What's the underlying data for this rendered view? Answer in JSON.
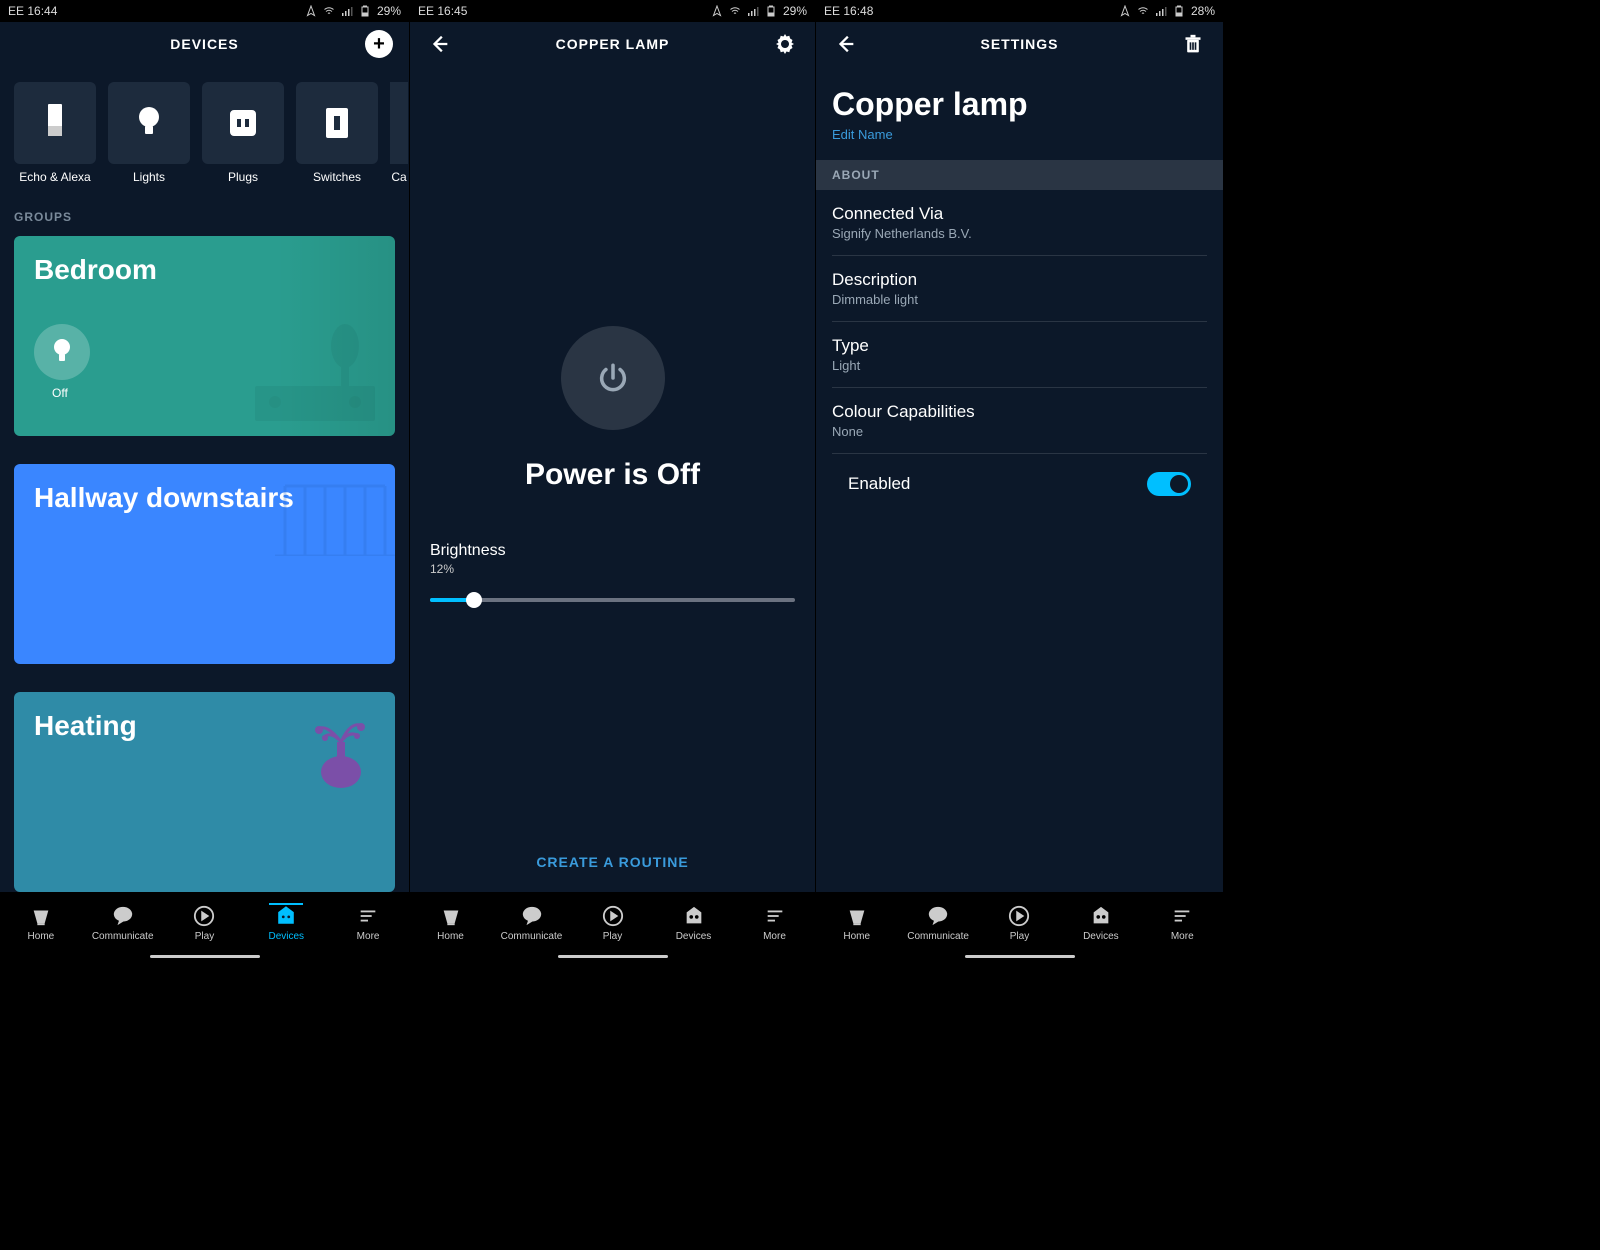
{
  "status": {
    "carrier": "EE",
    "battery_icon": "battery",
    "location_icon": "location",
    "wifi_icon": "wifi",
    "signal_icon": "signal"
  },
  "screen1": {
    "time": "16:44",
    "battery": "29%",
    "title": "DEVICES",
    "categories": [
      {
        "label": "Echo & Alexa",
        "icon": "echo"
      },
      {
        "label": "Lights",
        "icon": "bulb"
      },
      {
        "label": "Plugs",
        "icon": "plug"
      },
      {
        "label": "Switches",
        "icon": "switch"
      },
      {
        "label": "Ca",
        "icon": "camera"
      }
    ],
    "groups_header": "GROUPS",
    "groups": [
      {
        "name": "Bedroom",
        "state": "Off"
      },
      {
        "name": "Hallway downstairs"
      },
      {
        "name": "Heating"
      }
    ]
  },
  "screen2": {
    "time": "16:45",
    "battery": "29%",
    "title": "COPPER LAMP",
    "power_status": "Power is Off",
    "brightness_label": "Brightness",
    "brightness_value": "12%",
    "create_routine": "CREATE A ROUTINE"
  },
  "screen3": {
    "time": "16:48",
    "battery": "28%",
    "title": "SETTINGS",
    "device_name": "Copper lamp",
    "edit_name": "Edit Name",
    "about_header": "ABOUT",
    "rows": [
      {
        "label": "Connected Via",
        "value": "Signify Netherlands B.V."
      },
      {
        "label": "Description",
        "value": "Dimmable light"
      },
      {
        "label": "Type",
        "value": "Light"
      },
      {
        "label": "Colour Capabilities",
        "value": "None"
      }
    ],
    "enabled_label": "Enabled",
    "enabled": true
  },
  "nav": {
    "items": [
      {
        "label": "Home",
        "icon": "home"
      },
      {
        "label": "Communicate",
        "icon": "chat"
      },
      {
        "label": "Play",
        "icon": "play"
      },
      {
        "label": "Devices",
        "icon": "devices"
      },
      {
        "label": "More",
        "icon": "more"
      }
    ],
    "active_screen1": 3,
    "active_other": -1
  }
}
